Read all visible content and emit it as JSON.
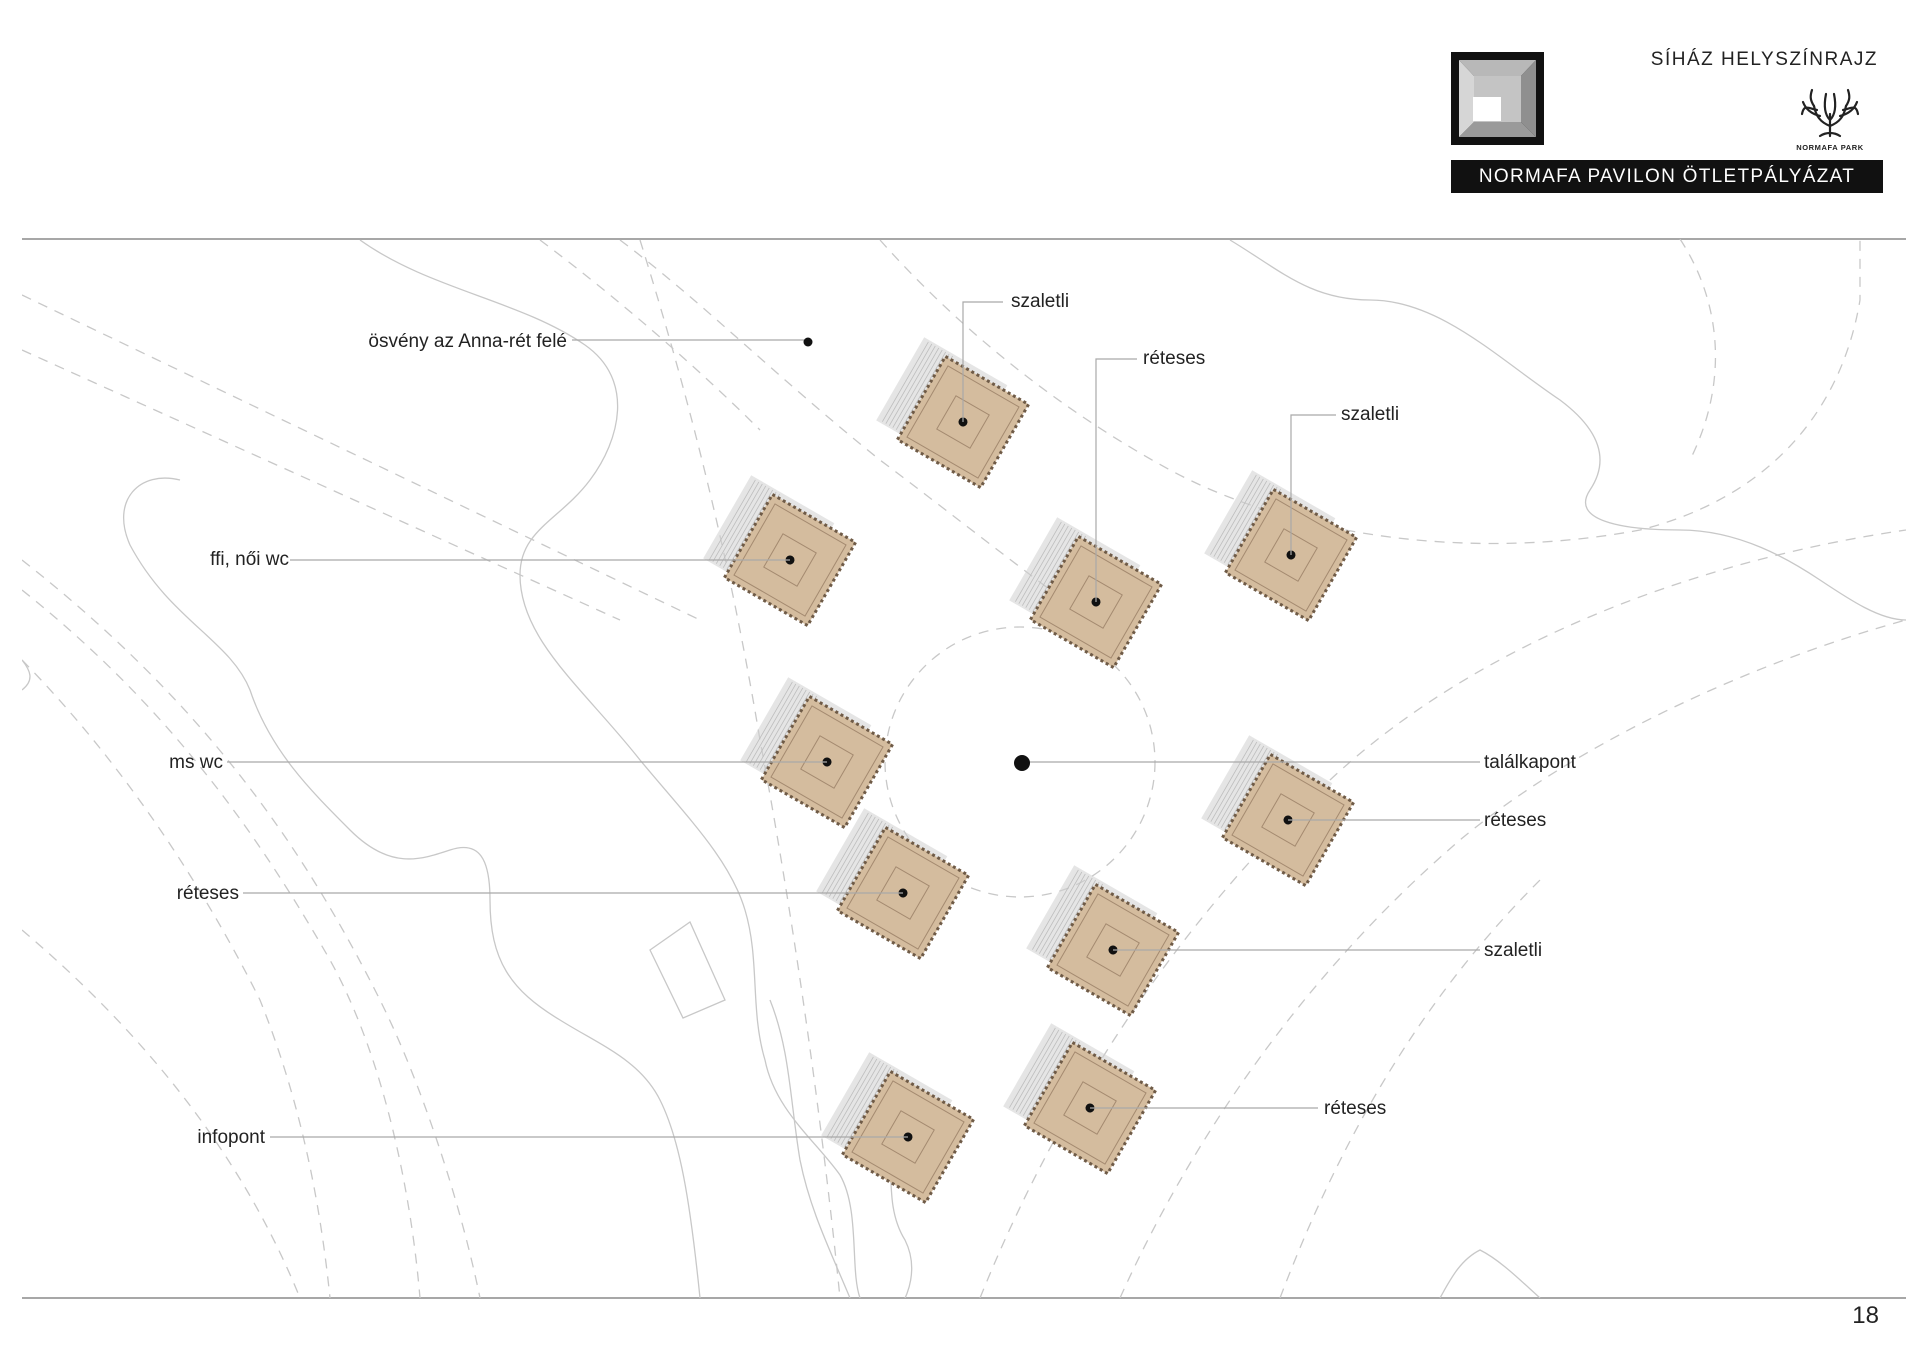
{
  "header": {
    "title": "SÍHÁZ HELYSZÍNRAJZ",
    "competition": "NORMAFA PAVILON ÖTLETPÁLYÁZAT",
    "park_logo_text": "NORMAFA PARK"
  },
  "page_number": "18",
  "labels": {
    "path_to_anna": "ösvény az Anna-rét felé",
    "szaletli_1": "szaletli",
    "reteses_1": "réteses",
    "szaletli_2": "szaletli",
    "wc": "ffi, női wc",
    "ms_wc": "ms wc",
    "meeting_point": "találkapont",
    "reteses_2": "réteses",
    "reteses_3": "réteses",
    "szaletli_3": "szaletli",
    "reteses_4": "réteses",
    "infopont": "infopont"
  },
  "colors": {
    "pavilion_fill": "#d4bc9e",
    "pavilion_edge": "#6f5b47",
    "shadow": "#d0d0d0",
    "map_line": "#c8c8c8",
    "leader_line": "#a9a9a9",
    "frame_line": "#8a8a8a",
    "dark": "#111111"
  }
}
